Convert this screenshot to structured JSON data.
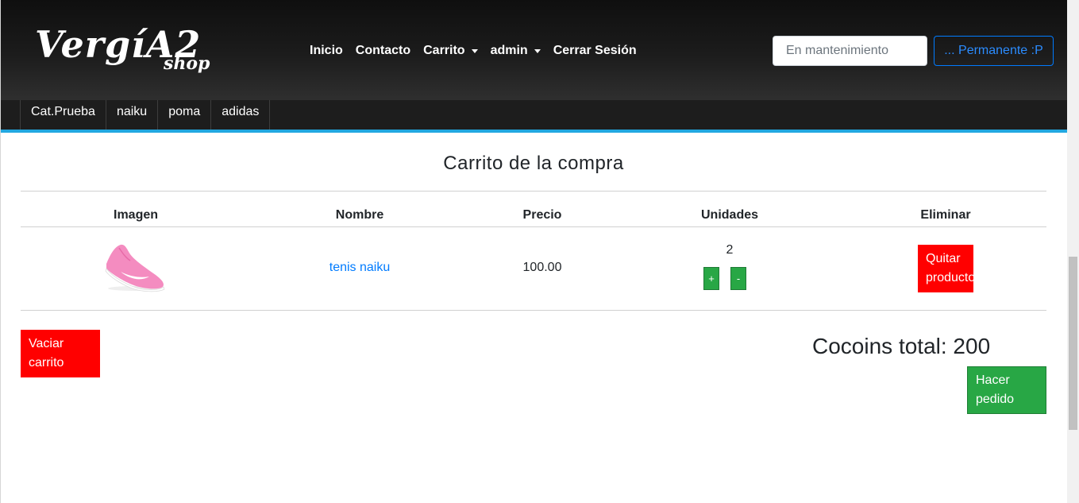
{
  "header": {
    "logo_main": "VergíA2",
    "logo_sub": "shop",
    "nav": {
      "inicio": "Inicio",
      "contacto": "Contacto",
      "carrito": "Carrito",
      "admin": "admin",
      "cerrar_sesion": "Cerrar Sesión"
    },
    "search_placeholder": "En mantenimiento",
    "permanent_button": "... Permanente :P"
  },
  "categories": [
    "Cat.Prueba",
    "naiku",
    "poma",
    "adidas"
  ],
  "cart": {
    "title": "Carrito de la compra",
    "columns": {
      "image": "Imagen",
      "name": "Nombre",
      "price": "Precio",
      "units": "Unidades",
      "remove": "Eliminar"
    },
    "items": [
      {
        "image_icon": "pink-sneaker-icon",
        "name": "tenis naiku",
        "price": "100.00",
        "units": "2",
        "plus_label": "+",
        "minus_label": "-",
        "remove_label": "Quitar producto"
      }
    ],
    "empty_cart_label": "Vaciar carrito",
    "total_label": "Cocoins total: 200",
    "order_label": "Hacer pedido"
  },
  "colors": {
    "accent_blue": "#007bff",
    "category_underline": "#22a7e0",
    "danger_red": "#ff0000",
    "success_green": "#28a745"
  }
}
